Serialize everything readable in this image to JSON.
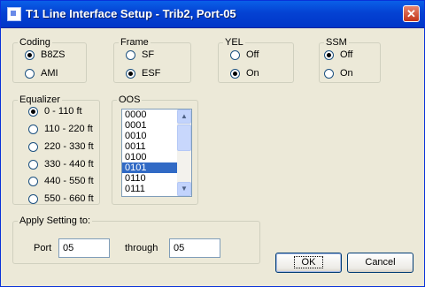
{
  "window": {
    "title": "T1 Line Interface Setup - Trib2, Port-05",
    "close_glyph": "✕"
  },
  "coding": {
    "label": "Coding",
    "options": [
      "B8ZS",
      "AMI"
    ],
    "selected": "B8ZS"
  },
  "frame": {
    "label": "Frame",
    "options": [
      "SF",
      "ESF"
    ],
    "selected": "ESF"
  },
  "yel": {
    "label": "YEL",
    "options": [
      "Off",
      "On"
    ],
    "selected": "On"
  },
  "ssm": {
    "label": "SSM",
    "options": [
      "Off",
      "On"
    ],
    "selected": "Off"
  },
  "equalizer": {
    "label": "Equalizer",
    "options": [
      "0 - 110 ft",
      "110 - 220 ft",
      "220 - 330 ft",
      "330 - 440 ft",
      "440 - 550 ft",
      "550 - 660 ft"
    ],
    "selected": "0 - 110 ft"
  },
  "oos": {
    "label": "OOS",
    "items": [
      "0000",
      "0001",
      "0010",
      "0011",
      "0100",
      "0101",
      "0110",
      "0111"
    ],
    "selected": "0101"
  },
  "apply": {
    "label": "Apply Setting to:",
    "port_label": "Port",
    "port_value": "05",
    "through_label": "through",
    "through_value": "05"
  },
  "buttons": {
    "ok": "OK",
    "cancel": "Cancel"
  },
  "colors": {
    "title_bar": "#0442d3",
    "selection": "#316ac5",
    "dialog_bg": "#ece9d8"
  }
}
